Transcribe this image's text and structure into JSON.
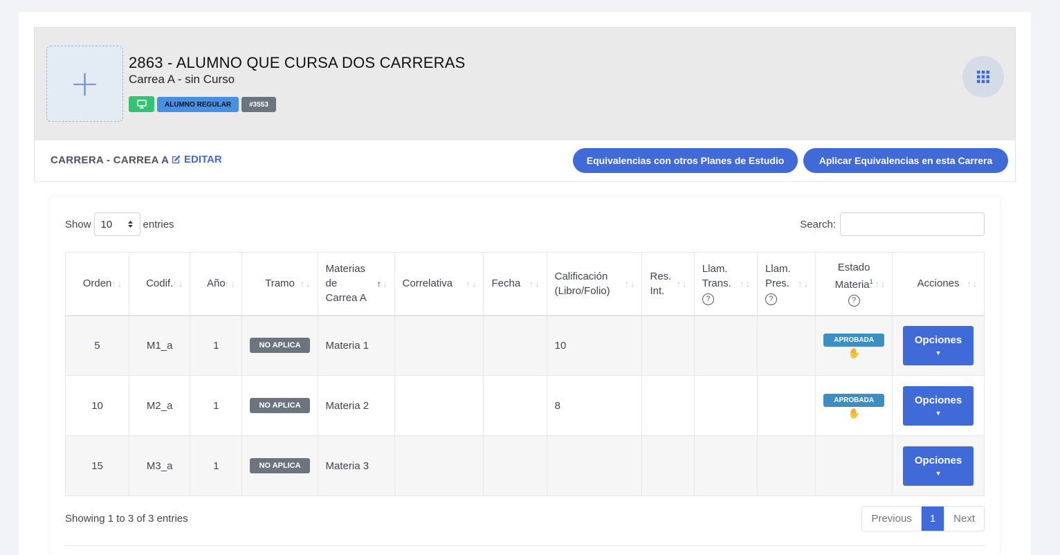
{
  "header": {
    "title": "2863 - ALUMNO QUE CURSA DOS CARRERAS",
    "subtitle": "Carrea A - sin Curso",
    "badges": {
      "regular": "ALUMNO REGULAR",
      "id": "#3553"
    },
    "avatar_icon": "plus-icon",
    "monitor_icon": "monitor-icon",
    "apps_icon": "grid-icon"
  },
  "career": {
    "label": "CARRERA - CARREA A",
    "edit_label": "EDITAR",
    "buttons": {
      "equivalencias_otros": "Equivalencias con otros Planes de Estudio",
      "aplicar_equivalencias": "Aplicar Equivalencias en esta Carrera"
    }
  },
  "table_controls": {
    "show_label": "Show",
    "entries_value": "10",
    "entries_label": "entries",
    "search_label": "Search:",
    "search_value": ""
  },
  "columns": {
    "orden": "Orden",
    "codif": "Codif.",
    "anio": "Año",
    "tramo": "Tramo",
    "materias_l1": "Materias",
    "materias_l2": "de",
    "materias_l3": "Carrea A",
    "correlativa": "Correlativa",
    "fecha": "Fecha",
    "calif_l1": "Calificación",
    "calif_l2": "(Libro/Folio)",
    "resint_l1": "Res.",
    "resint_l2": "Int.",
    "llamtrans_l1": "Llam.",
    "llamtrans_l2": "Trans.",
    "llampres_l1": "Llam.",
    "llampres_l2": "Pres.",
    "estado_l1": "Estado",
    "estado_l2": "Materia",
    "estado_sup": "1",
    "acciones": "Acciones",
    "help_glyph": "?"
  },
  "rows": [
    {
      "orden": "5",
      "codif": "M1_a",
      "anio": "1",
      "tramo": "NO APLICA",
      "materia": "Materia 1",
      "correlativa": "",
      "fecha": "",
      "calificacion": "10",
      "res_int": "",
      "llam_trans": "",
      "llam_pres": "",
      "estado": "APROBADA",
      "acciones": "Opciones"
    },
    {
      "orden": "10",
      "codif": "M2_a",
      "anio": "1",
      "tramo": "NO APLICA",
      "materia": "Materia 2",
      "correlativa": "",
      "fecha": "",
      "calificacion": "8",
      "res_int": "",
      "llam_trans": "",
      "llam_pres": "",
      "estado": "APROBADA",
      "acciones": "Opciones"
    },
    {
      "orden": "15",
      "codif": "M3_a",
      "anio": "1",
      "tramo": "NO APLICA",
      "materia": "Materia 3",
      "correlativa": "",
      "fecha": "",
      "calificacion": "",
      "res_int": "",
      "llam_trans": "",
      "llam_pres": "",
      "estado": "",
      "acciones": "Opciones"
    }
  ],
  "footer": {
    "info": "Showing 1 to 3 of 3 entries",
    "previous": "Previous",
    "current_page": "1",
    "next": "Next"
  },
  "colors": {
    "primary": "#3f6ad8",
    "success": "#35c274",
    "info": "#3e8fc1",
    "secondary": "#6c757d"
  }
}
